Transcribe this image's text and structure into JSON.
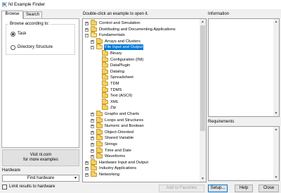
{
  "window": {
    "title": "NI Example Finder",
    "app_icon": "ni-icon"
  },
  "tabs": [
    {
      "label": "Browse",
      "active": true
    },
    {
      "label": "Search",
      "active": false
    }
  ],
  "browse": {
    "legend": "Browse according to:",
    "options": [
      {
        "label": "Task",
        "selected": true
      },
      {
        "label": "Directory Structure",
        "selected": false
      }
    ]
  },
  "visit": {
    "line1": "Visit ni.com",
    "line2": "for more examples"
  },
  "hardware": {
    "label": "Hardware",
    "select_value": "Find hardware",
    "limit_label": "Limit results to hardware",
    "limit_checked": false
  },
  "tree": {
    "header": "Double-click an example to open it.",
    "rows": [
      {
        "label": "Control and Simulation",
        "level": 0,
        "toggle": "+",
        "selected": false
      },
      {
        "label": "Distributing and Documenting Applications",
        "level": 0,
        "toggle": "+",
        "selected": false
      },
      {
        "label": "Fundamentals",
        "level": 0,
        "toggle": "-",
        "selected": false
      },
      {
        "label": "Arrays and Clusters",
        "level": 1,
        "toggle": "+",
        "selected": false
      },
      {
        "label": "File Input and Output",
        "level": 1,
        "toggle": "-",
        "selected": true
      },
      {
        "label": "Binary",
        "level": 2,
        "toggle": "",
        "selected": false
      },
      {
        "label": "Configuration (INI)",
        "level": 2,
        "toggle": "",
        "selected": false
      },
      {
        "label": "DataPlugin",
        "level": 2,
        "toggle": "",
        "selected": false
      },
      {
        "label": "Datalog",
        "level": 2,
        "toggle": "",
        "selected": false
      },
      {
        "label": "Spreadsheet",
        "level": 2,
        "toggle": "",
        "selected": false
      },
      {
        "label": "TDM",
        "level": 2,
        "toggle": "",
        "selected": false
      },
      {
        "label": "TDMS",
        "level": 2,
        "toggle": "",
        "selected": false
      },
      {
        "label": "Text (ASCII)",
        "level": 2,
        "toggle": "",
        "selected": false
      },
      {
        "label": "XML",
        "level": 2,
        "toggle": "",
        "selected": false
      },
      {
        "label": "Zip",
        "level": 2,
        "toggle": "",
        "selected": false
      },
      {
        "label": "Graphs and Charts",
        "level": 1,
        "toggle": "+",
        "selected": false
      },
      {
        "label": "Loops and Structures",
        "level": 1,
        "toggle": "+",
        "selected": false
      },
      {
        "label": "Numeric and Boolean",
        "level": 1,
        "toggle": "+",
        "selected": false
      },
      {
        "label": "Object-Oriented",
        "level": 1,
        "toggle": "+",
        "selected": false
      },
      {
        "label": "Shared Variable",
        "level": 1,
        "toggle": "+",
        "selected": false
      },
      {
        "label": "Strings",
        "level": 1,
        "toggle": "+",
        "selected": false
      },
      {
        "label": "Time and Date",
        "level": 1,
        "toggle": "+",
        "selected": false
      },
      {
        "label": "Waveforms",
        "level": 1,
        "toggle": "+",
        "selected": false
      },
      {
        "label": "Hardware Input and Output",
        "level": 0,
        "toggle": "+",
        "selected": false
      },
      {
        "label": "Industry Applications",
        "level": 0,
        "toggle": "+",
        "selected": false
      },
      {
        "label": "Networking",
        "level": 0,
        "toggle": "+",
        "selected": false
      }
    ]
  },
  "information": {
    "label": "Information"
  },
  "requirements": {
    "label": "Requirements"
  },
  "buttons": {
    "add_favorites": "Add to Favorites",
    "setup": "Setup...",
    "help": "Help",
    "close": "Close"
  },
  "colors": {
    "selection": "#0078d7",
    "folder": "#f4d163",
    "window_bg": "#f0f0f0"
  }
}
